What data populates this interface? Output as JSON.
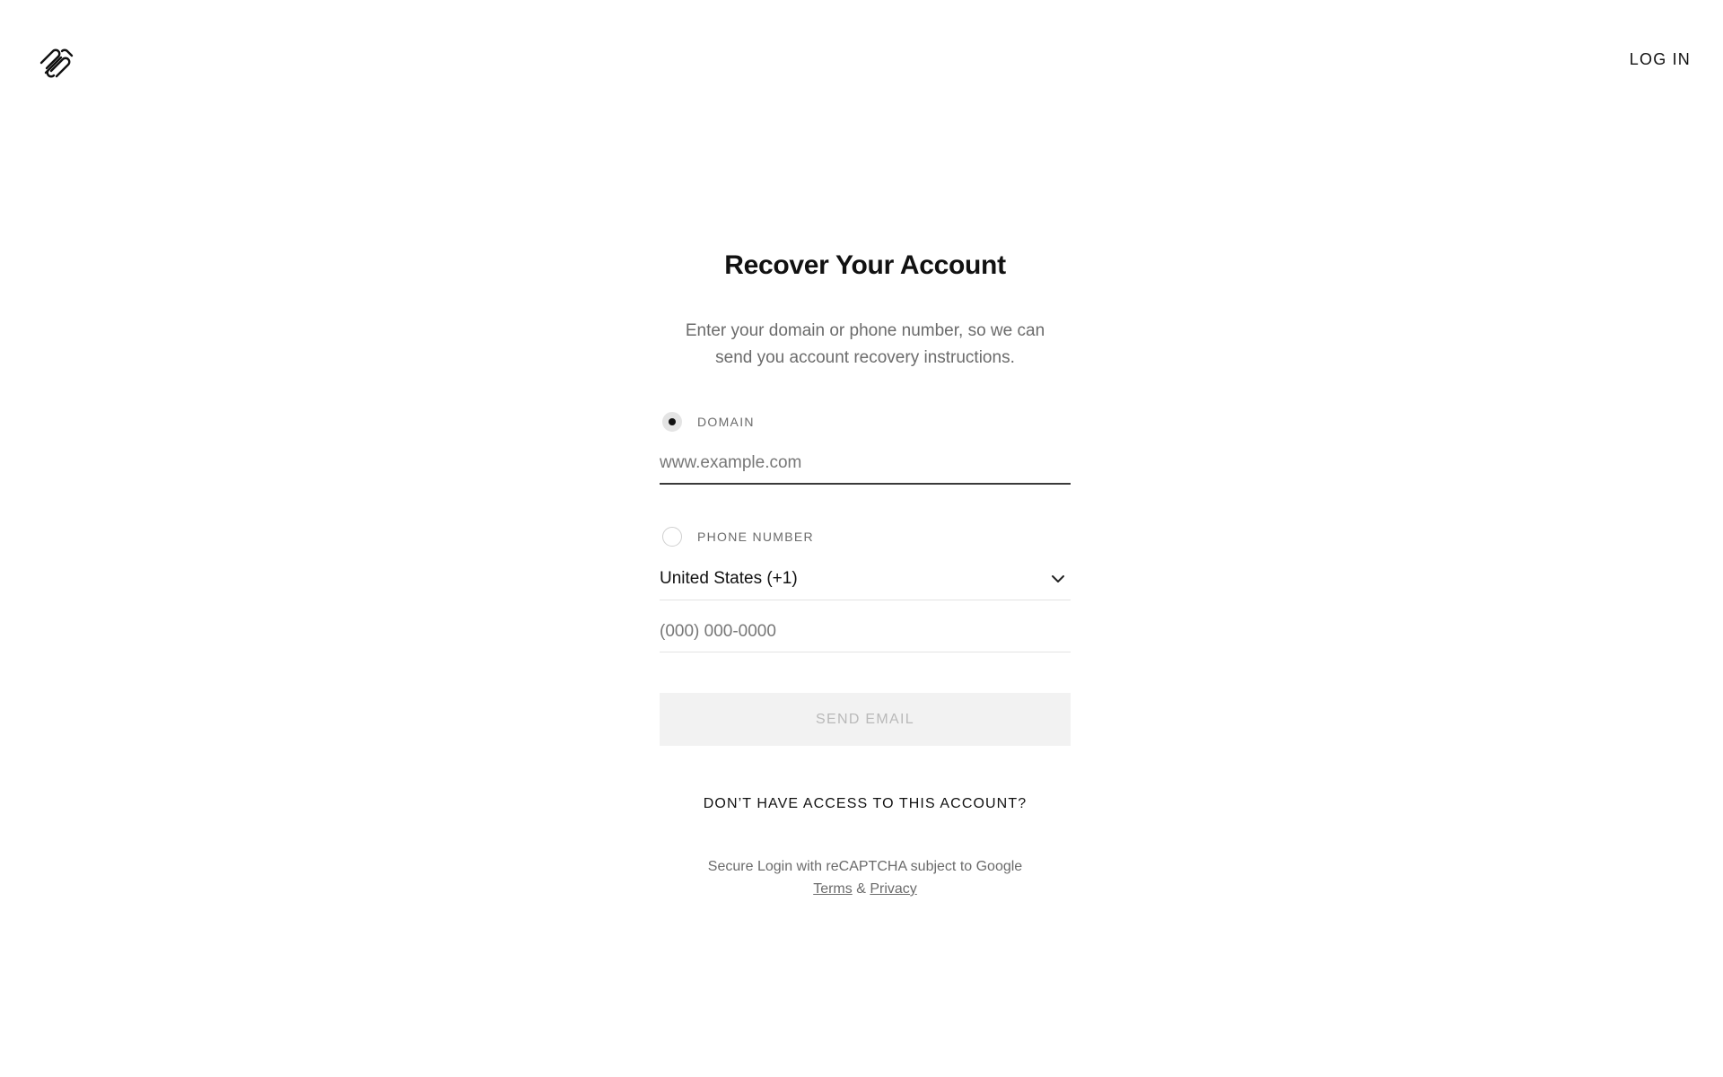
{
  "header": {
    "logo_icon": "squarespace-logo-icon",
    "login_label": "LOG IN"
  },
  "form": {
    "title": "Recover Your Account",
    "subtitle_line1": "Enter your domain or phone number, so we can",
    "subtitle_line2": "send you account recovery instructions.",
    "domain": {
      "label": "DOMAIN",
      "selected": true,
      "value": "",
      "placeholder": "www.example.com"
    },
    "phone": {
      "label": "PHONE NUMBER",
      "selected": false,
      "country_value": "United States (+1)",
      "country_icon": "chevron-down-icon",
      "value": "",
      "placeholder": "(000) 000-0000"
    },
    "send_button_label": "SEND EMAIL",
    "no_access_label": "DON’T HAVE ACCESS TO THIS ACCOUNT?",
    "recaptcha": {
      "text": "Secure Login with reCAPTCHA subject to Google",
      "terms_label": "Terms",
      "ampersand": "&",
      "privacy_label": "Privacy"
    }
  },
  "colors": {
    "text_primary": "#111111",
    "text_secondary": "#6b6b6b",
    "button_disabled_bg": "#f2f2f2",
    "button_disabled_text": "#b9b9b9",
    "input_active_border": "#3a3a3a",
    "input_border": "#e3e3e3"
  }
}
